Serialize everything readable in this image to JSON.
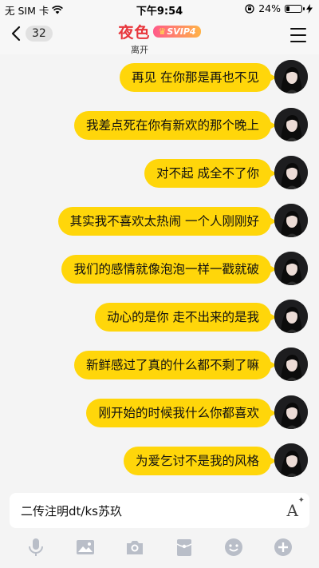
{
  "status_bar": {
    "carrier": "无 SIM 卡",
    "time": "下午9:54",
    "battery": "24%",
    "battery_level": 0.24
  },
  "header": {
    "unread_count": "32",
    "contact_name": "夜色",
    "badge": "SVIP4",
    "status": "离开"
  },
  "messages": [
    {
      "text": "再见 在你那是再也不见"
    },
    {
      "text": "我差点死在你有新欢的那个晚上"
    },
    {
      "text": "对不起 成全不了你"
    },
    {
      "text": "其实我不喜欢太热闹 一个人刚刚好"
    },
    {
      "text": "我们的感情就像泡泡一样一戳就破"
    },
    {
      "text": "动心的是你 走不出来的是我"
    },
    {
      "text": "新鲜感过了真的什么都不剩了嘛"
    },
    {
      "text": "刚开始的时候我什么你都喜欢"
    },
    {
      "text": "为爱乞讨不是我的风格"
    }
  ],
  "input": {
    "value": "二传注明dt/ks苏玖",
    "font_icon": "A"
  },
  "colors": {
    "bubble": "#ffd60a",
    "name": "#e8353b"
  },
  "toolbar_icons": [
    "microphone-icon",
    "image-icon",
    "camera-icon",
    "red-packet-icon",
    "emoji-icon",
    "plus-icon"
  ]
}
